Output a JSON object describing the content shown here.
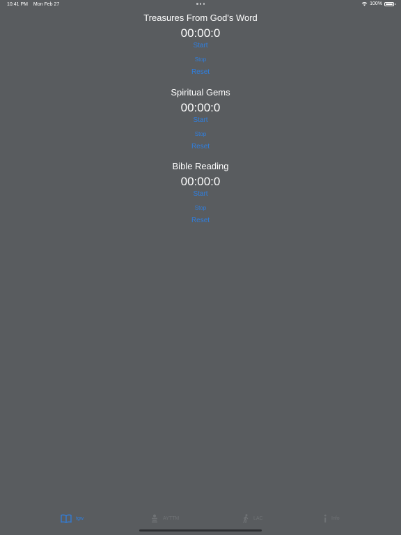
{
  "status_bar": {
    "time": "10:41 PM",
    "date": "Mon Feb 27",
    "battery": "100%"
  },
  "timers": [
    {
      "title": "Treasures From God's Word",
      "display": "00:00:0",
      "start_label": "Start",
      "stop_label": "Stop",
      "reset_label": "Reset"
    },
    {
      "title": "Spiritual Gems",
      "display": "00:00:0",
      "start_label": "Start",
      "stop_label": "Stop",
      "reset_label": "Reset"
    },
    {
      "title": "Bible Reading",
      "display": "00:00:0",
      "start_label": "Start",
      "stop_label": "Stop",
      "reset_label": "Reset"
    }
  ],
  "tab_bar": {
    "active_color": "#2f7fe0",
    "inactive_color": "#6f7275",
    "items": [
      {
        "label": "tgw",
        "icon": "book-icon",
        "active": true
      },
      {
        "label": "AYTTM",
        "icon": "people-icon",
        "active": false
      },
      {
        "label": "LAC",
        "icon": "walking-icon",
        "active": false
      },
      {
        "label": "Info",
        "icon": "info-icon",
        "active": false
      }
    ]
  }
}
